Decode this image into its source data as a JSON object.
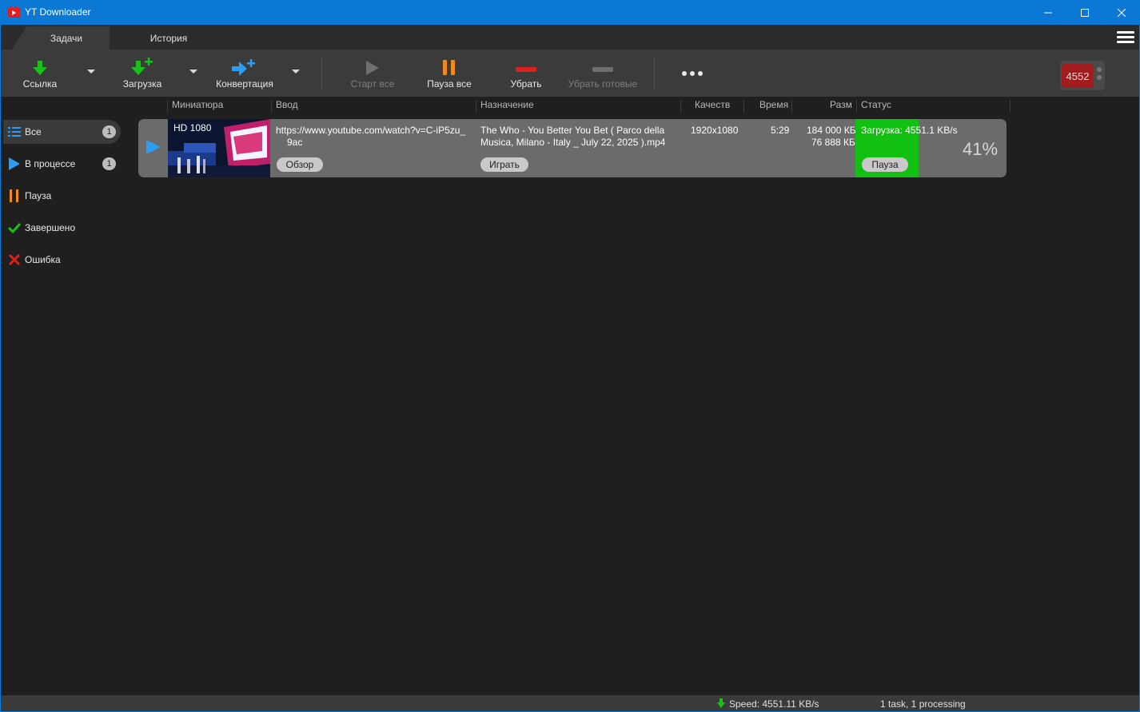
{
  "window": {
    "title": "YT Downloader",
    "accent": "#0a78d4"
  },
  "tabs": [
    {
      "label": "Задачи",
      "active": true
    },
    {
      "label": "История",
      "active": false
    }
  ],
  "toolbar": {
    "link_label": "Ссылка",
    "download_label": "Загрузка",
    "convert_label": "Конвертация",
    "start_all_label": "Старт все",
    "pause_all_label": "Пауза все",
    "remove_label": "Убрать",
    "remove_done_label": "Убрать готовые",
    "more_icon": "more-dots-icon",
    "counter": "4552"
  },
  "columns": {
    "thumbnail": "Миниатюра",
    "input": "Ввод",
    "destination": "Назначение",
    "quality": "Качеств",
    "time": "Время",
    "size": "Разм",
    "status": "Статус"
  },
  "sidebar": {
    "items": [
      {
        "label": "Все",
        "icon": "list-icon",
        "badge": "1",
        "color": "#2a9df4"
      },
      {
        "label": "В процессе",
        "icon": "play-icon",
        "badge": "1",
        "color": "#2a9df4"
      },
      {
        "label": "Пауза",
        "icon": "pause-icon",
        "color": "#f08a1c"
      },
      {
        "label": "Завершено",
        "icon": "check-icon",
        "color": "#19c219"
      },
      {
        "label": "Ошибка",
        "icon": "cross-icon",
        "color": "#e02020"
      }
    ]
  },
  "task": {
    "thumb_badge": "HD 1080",
    "url_line1": "https://www.youtube.com/watch?v=C-iP5zu_",
    "url_line2": "9ac",
    "browse_label": "Обзор",
    "dest_line1": "The Who - You Better You Bet ( Parco della",
    "dest_line2": "Musica, Milano - Italy _ July 22, 2025 ).mp4",
    "play_label": "Играть",
    "quality": "1920x1080",
    "time": "5:29",
    "size_total": "184 000 КБ",
    "size_done": "76 888 КБ",
    "status_text": "Загрузка: 4551.1 KB/s",
    "pause_label": "Пауза",
    "percent_text": "41%",
    "progress": 0.41,
    "status_color": "#12c012"
  },
  "statusbar": {
    "speed": "Speed: 4551.11 KB/s",
    "tasks": "1 task, 1 processing"
  }
}
